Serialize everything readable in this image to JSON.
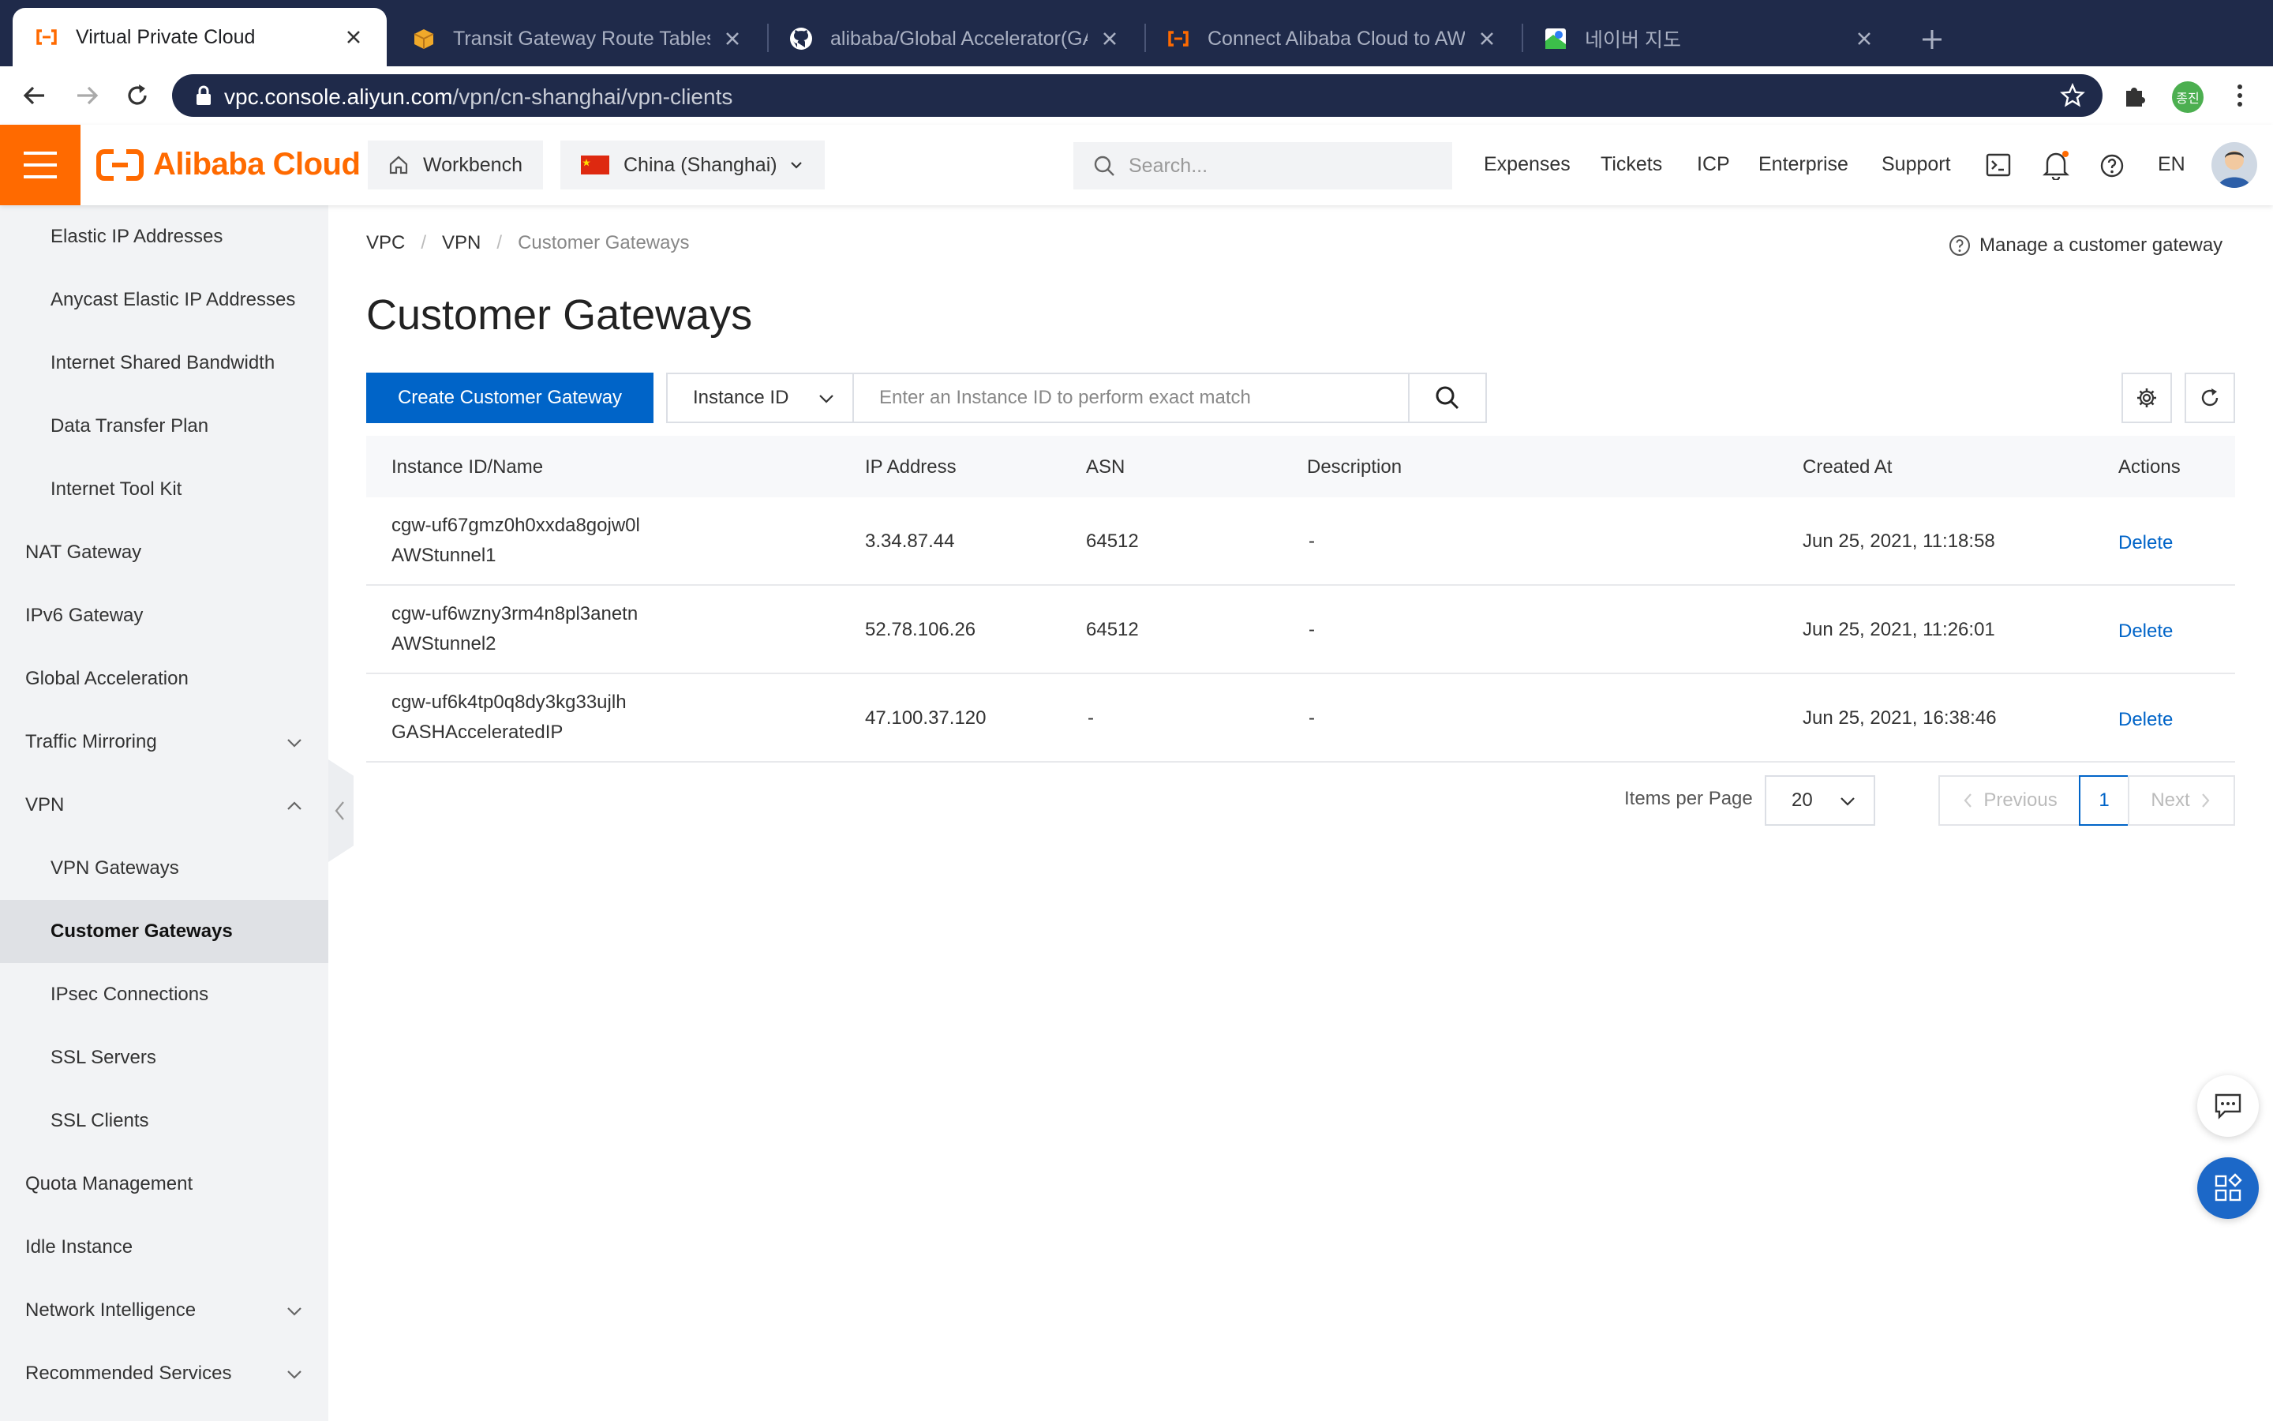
{
  "browser": {
    "tabs": [
      {
        "title": "Virtual Private Cloud",
        "icon": "alibaba-cloud-favicon",
        "active": true
      },
      {
        "title": "Transit Gateway Route Tables |",
        "icon": "aws-box-favicon"
      },
      {
        "title": "alibaba/Global Accelerator(GA)",
        "icon": "github-favicon"
      },
      {
        "title": "Connect Alibaba Cloud to AWS",
        "icon": "alibaba-cloud-favicon"
      },
      {
        "title": "네이버 지도",
        "icon": "naver-map-favicon"
      }
    ],
    "url_domain": "vpc.console.aliyun.com",
    "url_path": "/vpn/cn-shanghai/vpn-clients",
    "profile_badge": "종진"
  },
  "console": {
    "brand": "Alibaba Cloud",
    "workbench": "Workbench",
    "region": "China (Shanghai)",
    "search_placeholder": "Search...",
    "links": [
      "Expenses",
      "Tickets",
      "ICP",
      "Enterprise",
      "Support"
    ],
    "language": "EN",
    "accent_color": "#ff6a00",
    "primary_color": "#0064c8"
  },
  "sidebar": {
    "items": [
      {
        "label": "Elastic IP Addresses",
        "level": 2
      },
      {
        "label": "Anycast Elastic IP Addresses",
        "level": 2
      },
      {
        "label": "Internet Shared Bandwidth",
        "level": 2
      },
      {
        "label": "Data Transfer Plan",
        "level": 2
      },
      {
        "label": "Internet Tool Kit",
        "level": 2
      },
      {
        "label": "NAT Gateway",
        "level": 1
      },
      {
        "label": "IPv6 Gateway",
        "level": 1
      },
      {
        "label": "Global Acceleration",
        "level": 1
      },
      {
        "label": "Traffic Mirroring",
        "level": 1,
        "chevron": "down"
      },
      {
        "label": "VPN",
        "level": 1,
        "chevron": "up"
      },
      {
        "label": "VPN Gateways",
        "level": 2
      },
      {
        "label": "Customer Gateways",
        "level": 2,
        "active": true
      },
      {
        "label": "IPsec Connections",
        "level": 2
      },
      {
        "label": "SSL Servers",
        "level": 2
      },
      {
        "label": "SSL Clients",
        "level": 2
      },
      {
        "label": "Quota Management",
        "level": 1
      },
      {
        "label": "Idle Instance",
        "level": 1
      },
      {
        "label": "Network Intelligence",
        "level": 1,
        "chevron": "down"
      },
      {
        "label": "Recommended Services",
        "level": 1,
        "chevron": "down"
      }
    ]
  },
  "breadcrumb": [
    "VPC",
    "VPN",
    "Customer Gateways"
  ],
  "help_link": "Manage a customer gateway",
  "page_title": "Customer Gateways",
  "toolbar": {
    "create_label": "Create Customer Gateway",
    "filter_field": "Instance ID",
    "filter_placeholder": "Enter an Instance ID to perform exact match"
  },
  "table": {
    "headers": [
      "Instance ID/Name",
      "IP Address",
      "ASN",
      "Description",
      "Created At",
      "Actions"
    ],
    "rows": [
      {
        "id": "cgw-uf67gmz0h0xxda8gojw0l",
        "name": "AWStunnel1",
        "ip": "3.34.87.44",
        "asn": "64512",
        "description": "-",
        "created": "Jun 25, 2021, 11:18:58",
        "action": "Delete"
      },
      {
        "id": "cgw-uf6wzny3rm4n8pl3anetn",
        "name": "AWStunnel2",
        "ip": "52.78.106.26",
        "asn": "64512",
        "description": "-",
        "created": "Jun 25, 2021, 11:26:01",
        "action": "Delete"
      },
      {
        "id": "cgw-uf6k4tp0q8dy3kg33ujlh",
        "name": "GASHAcceleratedIP",
        "ip": "47.100.37.120",
        "asn": "-",
        "description": "-",
        "created": "Jun 25, 2021, 16:38:46",
        "action": "Delete"
      }
    ]
  },
  "pagination": {
    "items_per_page_label": "Items per Page",
    "page_size": "20",
    "previous": "Previous",
    "current_page": "1",
    "next": "Next"
  }
}
